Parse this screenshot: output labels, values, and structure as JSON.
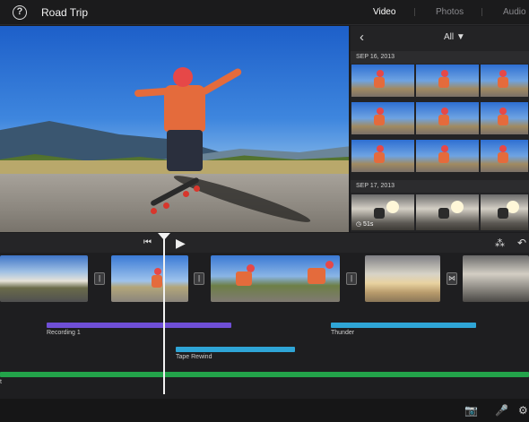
{
  "header": {
    "help_icon": "?",
    "title": "Road Trip",
    "tabs": [
      {
        "label": "Video",
        "active": true
      },
      {
        "label": "Photos",
        "active": false
      },
      {
        "label": "Audio",
        "active": false
      }
    ]
  },
  "browser": {
    "back_icon": "‹",
    "filter_label": "All ▼",
    "groups": [
      {
        "date": "SEP 16, 2013"
      },
      {
        "date": "SEP 17, 2013"
      }
    ],
    "duration_badge": "◷ 51s"
  },
  "timeline": {
    "skip_back_icon": "⏮",
    "play_icon": "▶",
    "waveform_icon": "⁂",
    "undo_icon": "↶",
    "transition_icon": "|",
    "transition_icon_special": "⋈",
    "audio_tracks": [
      {
        "label": "Recording 1",
        "color": "#6f4fd6"
      },
      {
        "label": "Thunder",
        "color": "#2fa5d6"
      },
      {
        "label": "Tape Rewind",
        "color": "#2fa5d6"
      },
      {
        "label": "t",
        "color": "#23a34a"
      }
    ]
  },
  "bottom": {
    "camera_icon": "📷",
    "mic_icon": "🎤",
    "settings_icon": "⚙"
  }
}
